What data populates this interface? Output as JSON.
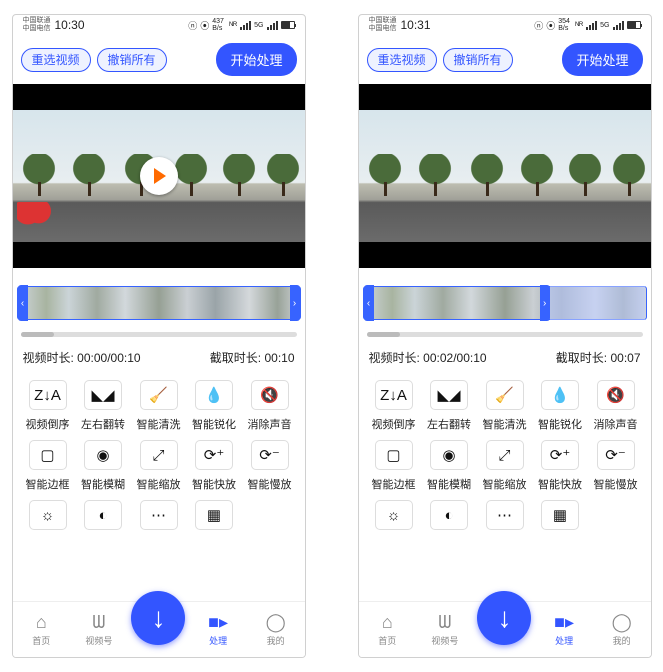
{
  "screens": [
    {
      "status": {
        "carrier1": "中国联通",
        "carrier2": "中国电信",
        "time": "10:30",
        "net_speed": "437 B/s"
      },
      "topbar": {
        "reselect": "重选视频",
        "undo_all": "撤销所有",
        "start_process": "开始处理"
      },
      "timeline": {
        "left_pct": 0,
        "right_pct": 100,
        "cover_left_pct": 0,
        "cover_width_pct": 0
      },
      "times": {
        "video_label": "视频时长:",
        "video_value": "00:00/00:10",
        "clip_label": "截取时长:",
        "clip_value": "00:10"
      },
      "tools_row1": [
        {
          "name": "tool-reverse",
          "icon": "Z↓A",
          "label": "视频倒序"
        },
        {
          "name": "tool-flip",
          "icon": "◣◢",
          "label": "左右翻转"
        },
        {
          "name": "tool-clean",
          "icon": "🧹",
          "label": "智能清洗"
        },
        {
          "name": "tool-sharpen",
          "icon": "💧",
          "label": "智能锐化"
        },
        {
          "name": "tool-mute",
          "icon": "🔇",
          "label": "消除声音"
        }
      ],
      "tools_row2": [
        {
          "name": "tool-border",
          "icon": "▢",
          "label": "智能边框"
        },
        {
          "name": "tool-blur",
          "icon": "◉",
          "label": "智能模糊"
        },
        {
          "name": "tool-zoom",
          "icon": "⤢",
          "label": "智能缩放"
        },
        {
          "name": "tool-fast",
          "icon": "⟳⁺",
          "label": "智能快放"
        },
        {
          "name": "tool-slow",
          "icon": "⟳⁻",
          "label": "智能慢放"
        }
      ],
      "tools_row3": [
        {
          "name": "tool-brightness",
          "icon": "☼",
          "label": ""
        },
        {
          "name": "tool-extra1",
          "icon": "◐",
          "label": ""
        },
        {
          "name": "tool-extra2",
          "icon": "⋯",
          "label": ""
        },
        {
          "name": "tool-extra3",
          "icon": "▦",
          "label": ""
        }
      ],
      "nav": {
        "home": "首页",
        "video_tab": "视频号",
        "process": "处理",
        "mine": "我的"
      },
      "show_play": true
    },
    {
      "status": {
        "carrier1": "中国联通",
        "carrier2": "中国电信",
        "time": "10:31",
        "net_speed": "354 B/s"
      },
      "topbar": {
        "reselect": "重选视频",
        "undo_all": "撤销所有",
        "start_process": "开始处理"
      },
      "timeline": {
        "left_pct": 0,
        "right_pct": 66,
        "cover_left_pct": 66,
        "cover_width_pct": 34
      },
      "times": {
        "video_label": "视频时长:",
        "video_value": "00:02/00:10",
        "clip_label": "截取时长:",
        "clip_value": "00:07"
      },
      "tools_row1": [
        {
          "name": "tool-reverse",
          "icon": "Z↓A",
          "label": "视频倒序"
        },
        {
          "name": "tool-flip",
          "icon": "◣◢",
          "label": "左右翻转"
        },
        {
          "name": "tool-clean",
          "icon": "🧹",
          "label": "智能清洗"
        },
        {
          "name": "tool-sharpen",
          "icon": "💧",
          "label": "智能锐化"
        },
        {
          "name": "tool-mute",
          "icon": "🔇",
          "label": "消除声音"
        }
      ],
      "tools_row2": [
        {
          "name": "tool-border",
          "icon": "▢",
          "label": "智能边框"
        },
        {
          "name": "tool-blur",
          "icon": "◉",
          "label": "智能模糊"
        },
        {
          "name": "tool-zoom",
          "icon": "⤢",
          "label": "智能缩放"
        },
        {
          "name": "tool-fast",
          "icon": "⟳⁺",
          "label": "智能快放"
        },
        {
          "name": "tool-slow",
          "icon": "⟳⁻",
          "label": "智能慢放"
        }
      ],
      "tools_row3": [
        {
          "name": "tool-brightness",
          "icon": "☼",
          "label": ""
        },
        {
          "name": "tool-extra1",
          "icon": "◐",
          "label": ""
        },
        {
          "name": "tool-extra2",
          "icon": "⋯",
          "label": ""
        },
        {
          "name": "tool-extra3",
          "icon": "▦",
          "label": ""
        }
      ],
      "nav": {
        "home": "首页",
        "video_tab": "视频号",
        "process": "处理",
        "mine": "我的"
      },
      "show_play": false
    }
  ]
}
